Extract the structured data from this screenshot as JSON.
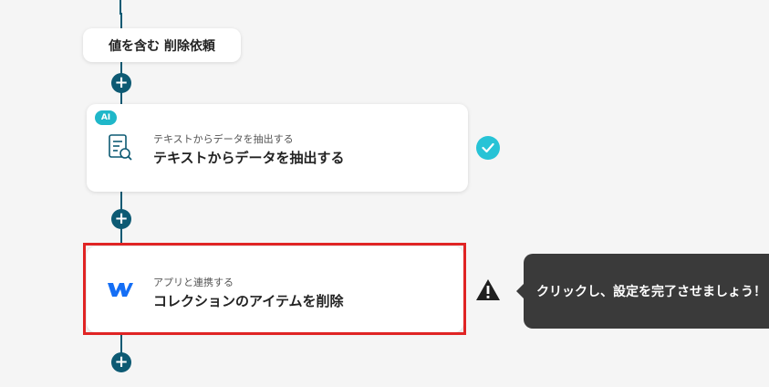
{
  "flow": {
    "trigger_pill": "値を含む 削除依頼",
    "steps": [
      {
        "badge": "AI",
        "subtitle": "テキストからデータを抽出する",
        "title": "テキストからデータを抽出する",
        "icon": "document-search-icon",
        "status": "completed"
      },
      {
        "subtitle": "アプリと連携する",
        "title": "コレクションのアイテムを削除",
        "icon": "webflow-logo-icon",
        "status": "warning"
      }
    ],
    "add_button_label": "+"
  },
  "tooltip": {
    "text": "クリックし、設定を完了させましょう！"
  },
  "colors": {
    "connector": "#0d5a73",
    "ai_badge": "#1fb7c9",
    "check": "#27c3d6",
    "highlight": "#e02424",
    "tooltip_bg": "#3a3a3a",
    "webflow": "#146ef5"
  }
}
